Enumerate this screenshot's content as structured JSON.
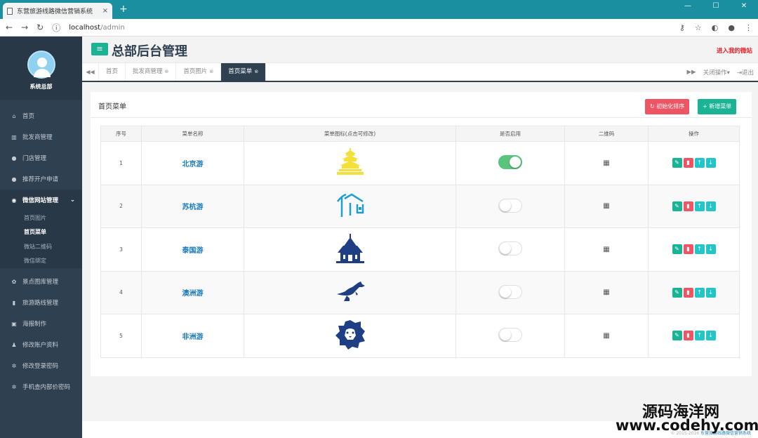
{
  "browser": {
    "tab_title": "东营旅游线路微信营销系统",
    "tab_close": "×",
    "new_tab": "+",
    "url_host": "localhost",
    "url_path": "/admin",
    "win_min": "—",
    "win_max": "☐",
    "win_close": "✕"
  },
  "sidebar": {
    "profile_name": "系统总部",
    "items": [
      {
        "label": "首页",
        "icon": "home-icon"
      },
      {
        "label": "批发商管理",
        "icon": "bank-icon"
      },
      {
        "label": "门店管理",
        "icon": "users-icon"
      },
      {
        "label": "推荐开户申请",
        "icon": "users-icon"
      },
      {
        "label": "微信网站管理",
        "icon": "wechat-icon"
      },
      {
        "label": "景点图库管理",
        "icon": "gear-icon"
      },
      {
        "label": "旅游路线管理",
        "icon": "book-icon"
      },
      {
        "label": "海报制作",
        "icon": "picture-icon"
      },
      {
        "label": "修改账户资料",
        "icon": "user-icon"
      },
      {
        "label": "修改登录密码",
        "icon": "gear-icon"
      },
      {
        "label": "手机查内部价密码",
        "icon": "gear-icon"
      }
    ],
    "sub_items": [
      "首页图片",
      "首页菜单",
      "微站二维码",
      "微信绑定"
    ]
  },
  "header": {
    "title": "总部后台管理",
    "enter_link": "进入我的微站"
  },
  "tabs": {
    "items": [
      "首页",
      "批发商管理",
      "首页图片",
      "首页菜单"
    ],
    "close_ops": "关闭操作",
    "logout": "退出"
  },
  "panel": {
    "title": "首页菜单",
    "reset_button": "初始化排序",
    "add_button": "新增菜单"
  },
  "table": {
    "columns": [
      "序号",
      "菜单名称",
      "菜单图标(点击可修改)",
      "是否启用",
      "二维码",
      "操作"
    ],
    "rows": [
      {
        "no": "1",
        "name": "北京游",
        "enabled": true
      },
      {
        "no": "2",
        "name": "苏杭游",
        "enabled": false
      },
      {
        "no": "3",
        "name": "泰国游",
        "enabled": false
      },
      {
        "no": "4",
        "name": "澳洲游",
        "enabled": false
      },
      {
        "no": "5",
        "name": "非洲游",
        "enabled": false
      }
    ]
  },
  "footer": {
    "copyright": "© 2015-2016",
    "link": "东营旅游线路微信营销系统"
  },
  "watermark": {
    "line1": "源码海洋网",
    "line2": "www.codehy.com"
  },
  "colors": {
    "accent": "#1ab394",
    "sidebar": "#2f4050",
    "danger": "#ed5565",
    "info": "#23c6c8",
    "link": "#1a7bb9"
  }
}
